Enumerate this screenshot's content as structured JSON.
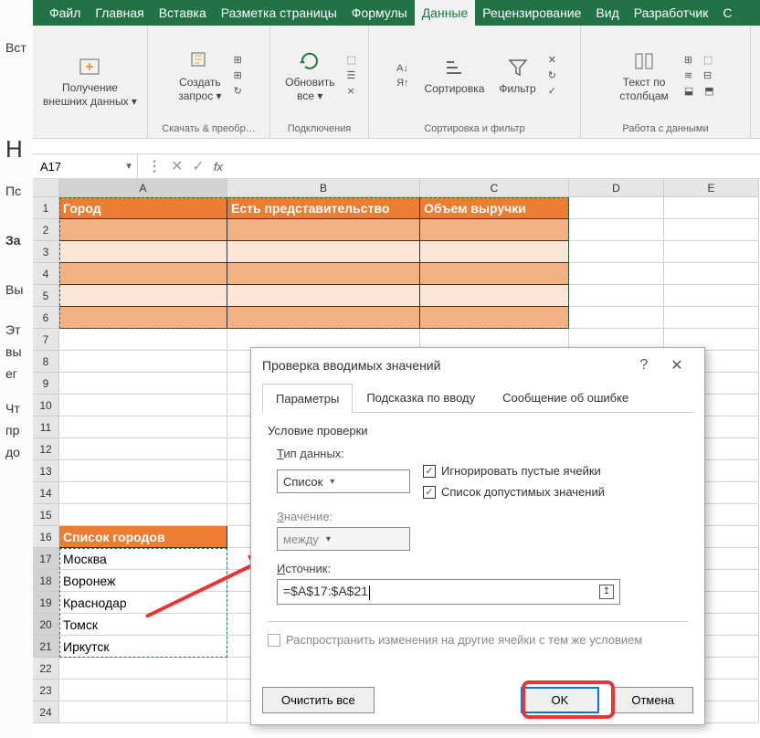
{
  "left_sliver": {
    "items": [
      "Вст",
      "",
      "",
      "Н",
      "Пс",
      "За",
      "",
      "Вы",
      "",
      "Эт",
      "вы",
      "ег",
      "",
      "Чт",
      "пр",
      "до"
    ]
  },
  "tabs": [
    "Файл",
    "Главная",
    "Вставка",
    "Разметка страницы",
    "Формулы",
    "Данные",
    "Рецензирование",
    "Вид",
    "Разработчик",
    "С"
  ],
  "active_tab_index": 5,
  "ribbon_groups": [
    {
      "label": "",
      "buttons": [
        {
          "label": "Получение\nвнешних данных ▾",
          "icon": "import-icon"
        }
      ]
    },
    {
      "label": "Скачать & преобр…",
      "buttons": [
        {
          "label": "Создать\nзапрос ▾",
          "icon": "query-icon"
        }
      ],
      "minis": [
        "⊞",
        "⊞",
        "↻"
      ]
    },
    {
      "label": "Подключения",
      "buttons": [
        {
          "label": "Обновить\nвсе ▾",
          "icon": "refresh-icon"
        }
      ],
      "minis": [
        "⬚",
        "☰",
        "⨯"
      ]
    },
    {
      "label": "Сортировка и фильтр",
      "buttons": [
        {
          "label": "",
          "icon": "sort-az-icon"
        },
        {
          "label": "Сортировка",
          "icon": "sort-icon"
        },
        {
          "label": "Фильтр",
          "icon": "filter-icon"
        }
      ],
      "minis": [
        "А↓",
        "Я↑"
      ]
    },
    {
      "label": "Работа с данными",
      "buttons": [
        {
          "label": "Текст по\nстолбцам",
          "icon": "text-cols-icon"
        }
      ],
      "minis": [
        "⊞",
        "⬚",
        "≋",
        "⊟",
        "⬓",
        "⬒"
      ]
    }
  ],
  "namebox": "A17",
  "columns": [
    "A",
    "B",
    "C",
    "D",
    "E"
  ],
  "rows": [
    1,
    2,
    3,
    4,
    5,
    6,
    7,
    8,
    9,
    10,
    11,
    12,
    13,
    14,
    15,
    16,
    17,
    18,
    19,
    20,
    21,
    22,
    23,
    24
  ],
  "table_hdr": {
    "a": "Город",
    "b": "Есть представительство",
    "c": "Объем выручки"
  },
  "list_header": "Список городов",
  "city_list": [
    "Москва",
    "Воронеж",
    "Краснодар",
    "Томск",
    "Иркутск"
  ],
  "dialog": {
    "title": "Проверка вводимых значений",
    "tabs": [
      "Параметры",
      "Подсказка по вводу",
      "Сообщение об ошибке"
    ],
    "section_label": "Условие проверки",
    "type_label": "Тип данных:",
    "type_value": "Список",
    "cb_ignore": "Игнорировать пустые ячейки",
    "cb_dropdown": "Список допустимых значений",
    "value_label": "Значение:",
    "value_value": "между",
    "source_label": "Источник:",
    "source_value": "=$A$17:$A$21",
    "propagate": "Распространить изменения на другие ячейки с тем же условием",
    "clear_all": "Очистить все",
    "ok": "OK",
    "cancel": "Отмена",
    "help": "?",
    "close": "✕"
  }
}
